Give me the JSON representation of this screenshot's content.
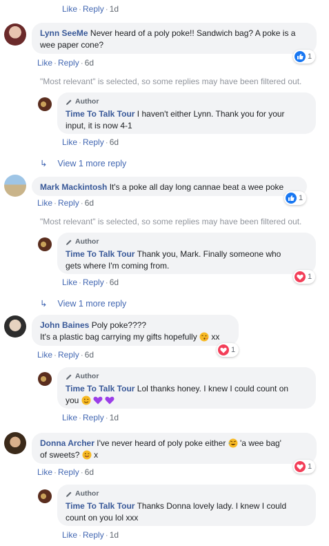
{
  "labels": {
    "like": "Like",
    "reply": "Reply",
    "sep": "·",
    "author": "Author",
    "filter_notice": "\"Most relevant\" is selected, so some replies may have been filtered out.",
    "view_more": "View 1 more reply"
  },
  "top": {
    "time": "1d"
  },
  "comments": [
    {
      "name": "Lynn SeeMe",
      "text": "Never heard of a poly poke!! Sandwich bag? A poke is a wee paper cone?",
      "time": "6d",
      "reaction": "like",
      "reaction_count": "1"
    },
    {
      "name": "Mark Mackintosh",
      "text": "It's a poke all day long cannae beat a wee poke",
      "time": "6d",
      "reaction": "like",
      "reaction_count": "1"
    },
    {
      "name": "John Baines",
      "text_line1": "Poly poke????",
      "text_line2": "It's a plastic bag carrying my gifts hopefully",
      "text_suffix": "xx",
      "time": "6d",
      "reaction": "love",
      "reaction_count": "1"
    },
    {
      "name": "Donna Archer",
      "text_line1": "I've never heard of poly poke either",
      "text_mid": "'a wee bag'",
      "text_line2": "of sweets?",
      "text_suffix": "x",
      "time": "6d",
      "reaction": "love",
      "reaction_count": "1"
    }
  ],
  "replies": [
    {
      "name": "Time To Talk Tour",
      "text_line1": "I haven't either Lynn. Thank you for your",
      "text_line2": "input, it is now 4-1",
      "time": "6d"
    },
    {
      "name": "Time To Talk Tour",
      "text_line1": "Thank you, Mark. Finally someone who",
      "text_line2": "gets where I'm coming from.",
      "time": "6d",
      "reaction": "love",
      "reaction_count": "1"
    },
    {
      "name": "Time To Talk Tour",
      "text_line1": "Lol thanks honey. I knew I could count on",
      "text_line2": "you",
      "time": "1d"
    },
    {
      "name": "Time To Talk Tour",
      "text_line1": "Thanks Donna lovely lady. I knew I could",
      "text_line2": "count on you lol xxx",
      "time": "1d"
    }
  ],
  "colors": {
    "link": "#385898",
    "action": "#4267b2",
    "bubble": "#f2f3f5",
    "like": "#1877f2",
    "love": "#f33e58"
  }
}
